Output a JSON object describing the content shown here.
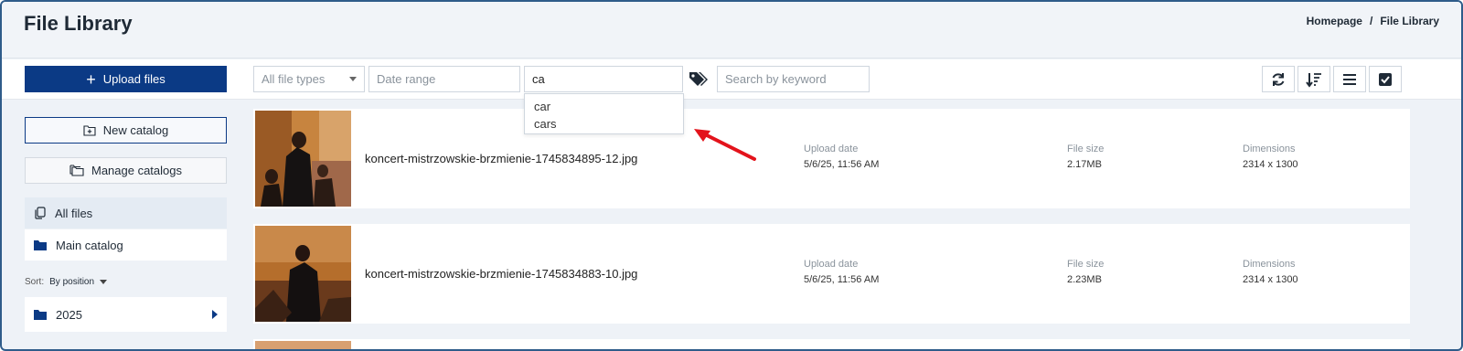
{
  "header": {
    "title": "File Library",
    "breadcrumb": [
      "Homepage",
      "/",
      "File Library"
    ]
  },
  "toolbar": {
    "upload_label": "Upload files",
    "file_types": "All file types",
    "date_placeholder": "Date range",
    "tag_value": "ca",
    "keyword_placeholder": "Search by keyword",
    "suggestions": [
      "car",
      "cars"
    ],
    "icons": [
      "refresh-icon",
      "sort-icon",
      "list-view-icon",
      "select-all-icon"
    ]
  },
  "sidebar": {
    "new_catalog": "New catalog",
    "manage_catalogs": "Manage catalogs",
    "all_files": "All files",
    "main_catalog": "Main catalog",
    "sort_label": "Sort:",
    "sort_value": "By position",
    "year_folder": "2025"
  },
  "files": [
    {
      "name": "koncert-mistrzowskie-brzmienie-1745834895-12.jpg",
      "upload_label": "Upload date",
      "upload_value": "5/6/25, 11:56 AM",
      "size_label": "File size",
      "size_value": "2.17MB",
      "dim_label": "Dimensions",
      "dim_value": "2314 x 1300"
    },
    {
      "name": "koncert-mistrzowskie-brzmienie-1745834883-10.jpg",
      "upload_label": "Upload date",
      "upload_value": "5/6/25, 11:56 AM",
      "size_label": "File size",
      "size_value": "2.23MB",
      "dim_label": "Dimensions",
      "dim_value": "2314 x 1300"
    }
  ],
  "colors": {
    "primary": "#0b3a85",
    "annotation_arrow": "#e3131b"
  }
}
